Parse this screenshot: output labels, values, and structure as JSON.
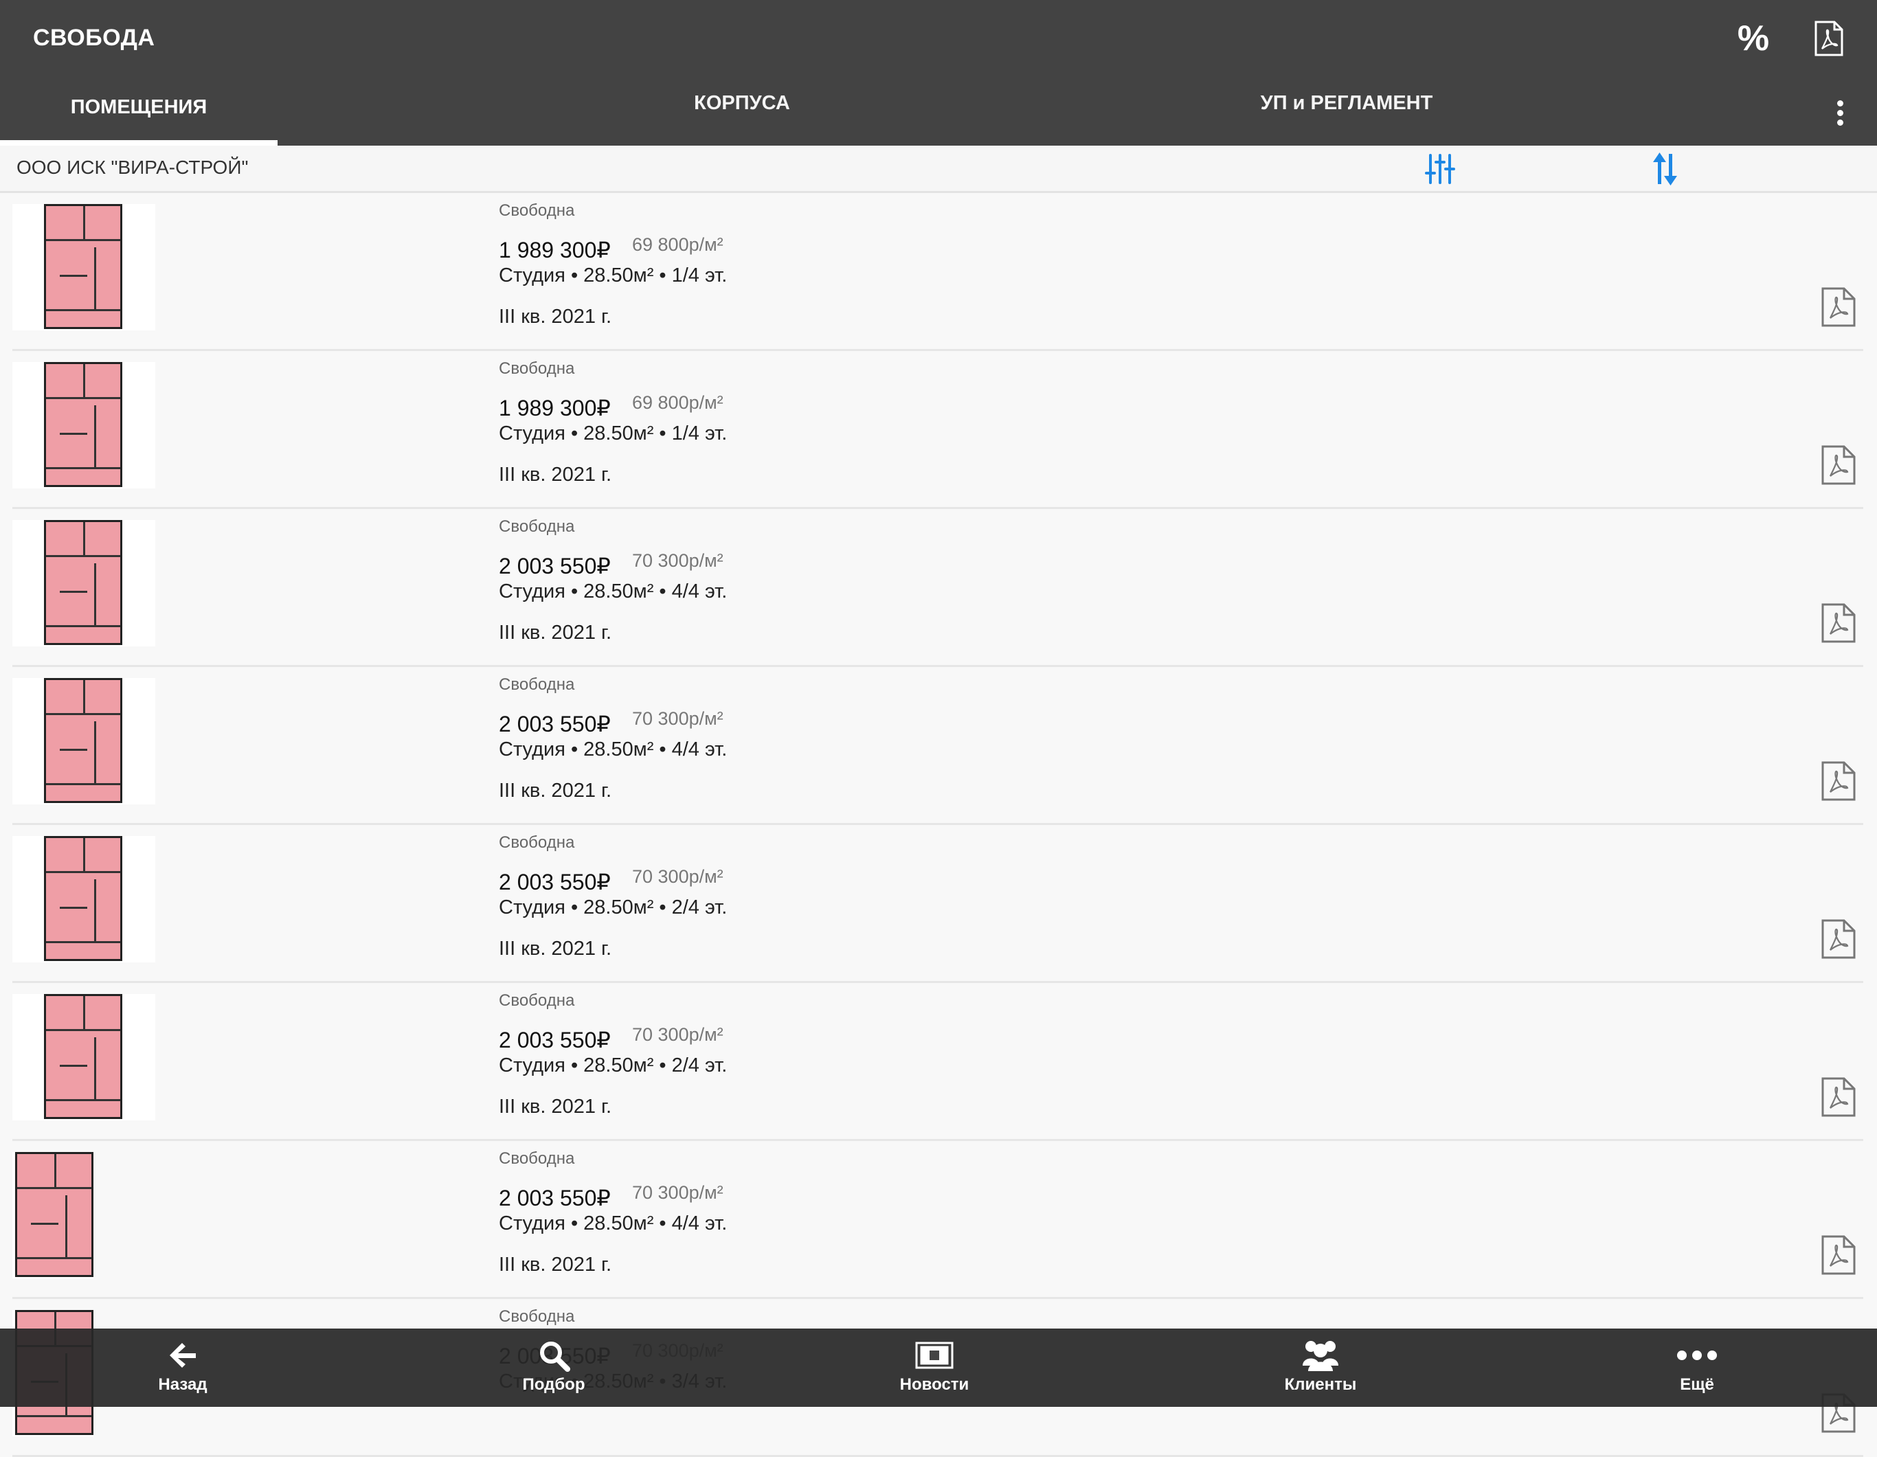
{
  "app": {
    "title": "СВОБОДА"
  },
  "icons": {
    "discount": "percent-icon",
    "pdf": "pdf-icon",
    "more": "more-vert-icon",
    "filter": "filter-sliders-icon",
    "sort": "sort-arrows-icon"
  },
  "appbar": {
    "discount_label": "%"
  },
  "tabs": [
    {
      "label": "ПОМЕЩЕНИЯ",
      "active": true
    },
    {
      "label": "КОРПУСА",
      "active": false
    },
    {
      "label": "УП и РЕГЛАМЕНТ",
      "active": false
    }
  ],
  "filter": {
    "developer": "ООО ИСК \"ВИРА-СТРОЙ\""
  },
  "colors": {
    "appbar": "#434343",
    "accent": "#1e88e5",
    "plan_fill": "#ef9ea6"
  },
  "listings": [
    {
      "status": "Свободна",
      "price": "1 989 300₽",
      "price_per_m2": "69 800р/м²",
      "details": "Студия • 28.50м² • 1/4 эт.",
      "quarter": "III кв. 2021 г."
    },
    {
      "status": "Свободна",
      "price": "1 989 300₽",
      "price_per_m2": "69 800р/м²",
      "details": "Студия • 28.50м² • 1/4 эт.",
      "quarter": "III кв. 2021 г."
    },
    {
      "status": "Свободна",
      "price": "2 003 550₽",
      "price_per_m2": "70 300р/м²",
      "details": "Студия • 28.50м² • 4/4 эт.",
      "quarter": "III кв. 2021 г."
    },
    {
      "status": "Свободна",
      "price": "2 003 550₽",
      "price_per_m2": "70 300р/м²",
      "details": "Студия • 28.50м² • 4/4 эт.",
      "quarter": "III кв. 2021 г."
    },
    {
      "status": "Свободна",
      "price": "2 003 550₽",
      "price_per_m2": "70 300р/м²",
      "details": "Студия • 28.50м² • 2/4 эт.",
      "quarter": "III кв. 2021 г."
    },
    {
      "status": "Свободна",
      "price": "2 003 550₽",
      "price_per_m2": "70 300р/м²",
      "details": "Студия • 28.50м² • 2/4 эт.",
      "quarter": "III кв. 2021 г."
    },
    {
      "status": "Свободна",
      "price": "2 003 550₽",
      "price_per_m2": "70 300р/м²",
      "details": "Студия • 28.50м² • 4/4 эт.",
      "quarter": "III кв. 2021 г."
    },
    {
      "status": "Свободна",
      "price": "2 003 550₽",
      "price_per_m2": "70 300р/м²",
      "details": "Студия • 28.50м² • 3/4 эт.",
      "quarter": ""
    }
  ],
  "bottom_nav": [
    {
      "label": "Назад",
      "icon": "arrow-back-icon"
    },
    {
      "label": "Подбор",
      "icon": "search-icon"
    },
    {
      "label": "Новости",
      "icon": "news-icon"
    },
    {
      "label": "Клиенты",
      "icon": "clients-icon"
    },
    {
      "label": "Ещё",
      "icon": "more-horiz-icon"
    }
  ]
}
